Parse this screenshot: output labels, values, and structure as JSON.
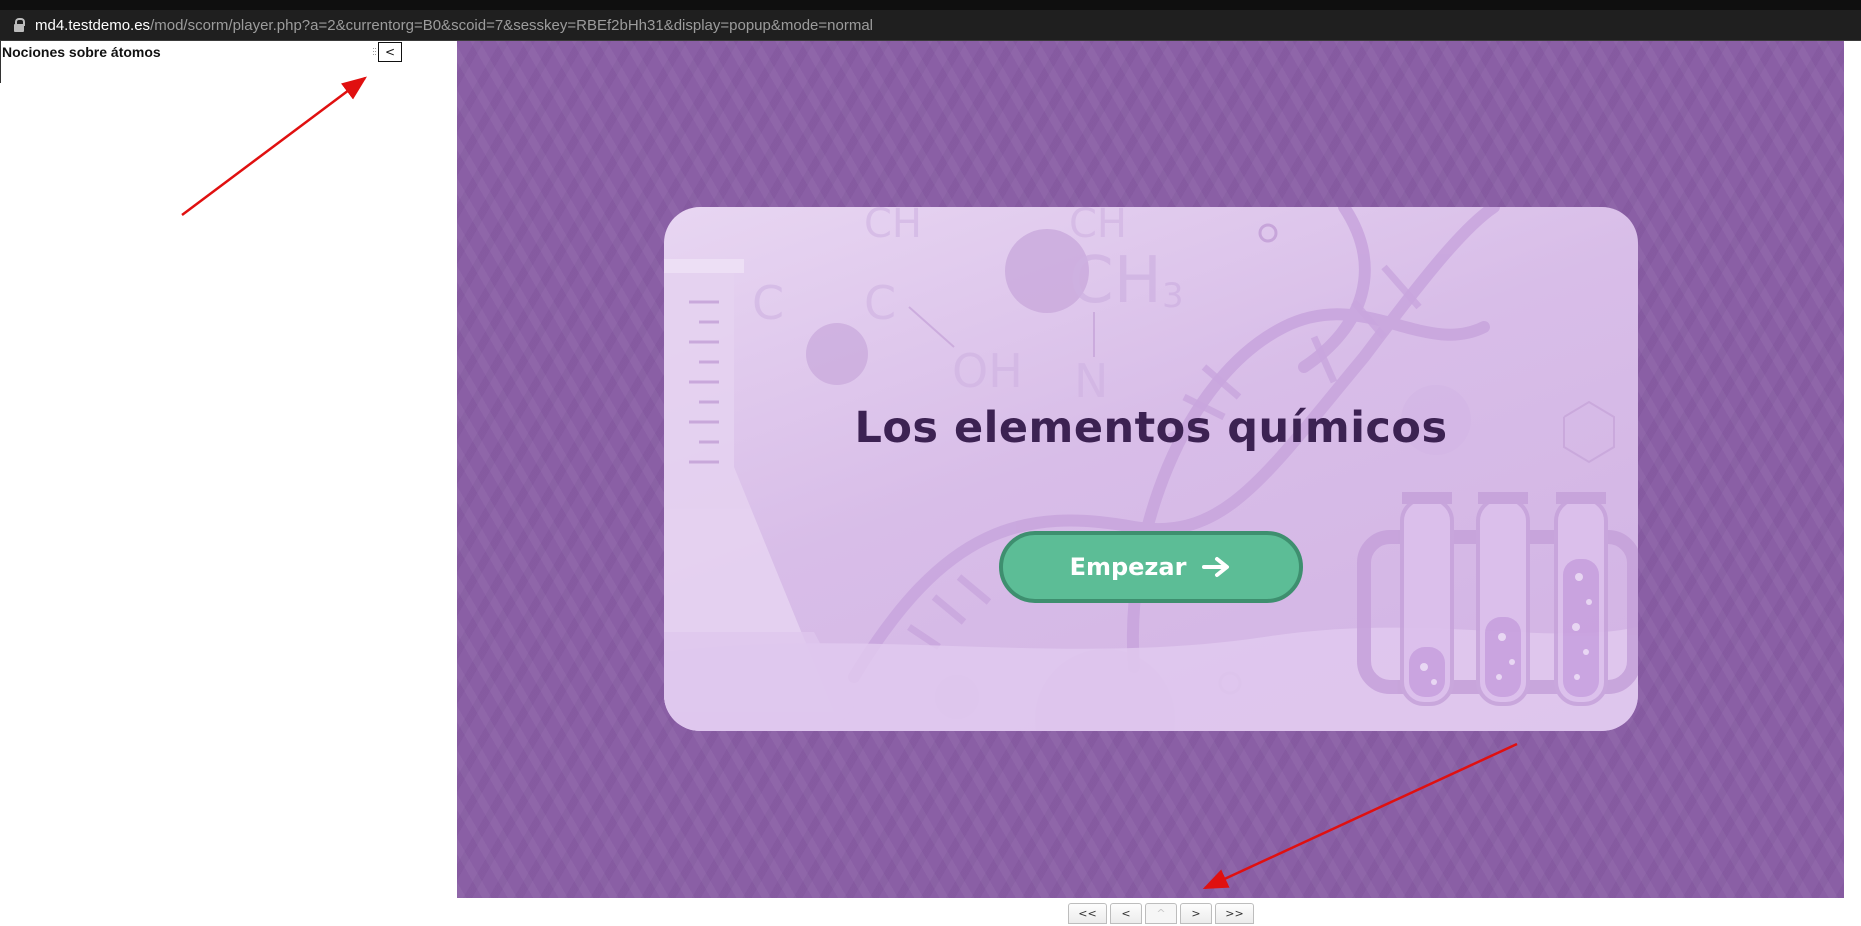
{
  "browser": {
    "url_host": "md4.testdemo.es",
    "url_path": "/mod/scorm/player.php?a=2&currentorg=B0&scoid=7&sesskey=RBEf2bHh31&display=popup&mode=normal"
  },
  "toc": {
    "title": "Nociones sobre átomos",
    "toggle_label": "<"
  },
  "content": {
    "title": "Los elementos químicos",
    "start_label": "Empezar",
    "background_color": "#8a5fa5",
    "button_color": "#5cbd96"
  },
  "nav": {
    "first": "<<",
    "prev": "<",
    "up": "^",
    "next": ">",
    "last": ">>"
  },
  "annotations": {
    "arrow_color": "#e01010"
  }
}
